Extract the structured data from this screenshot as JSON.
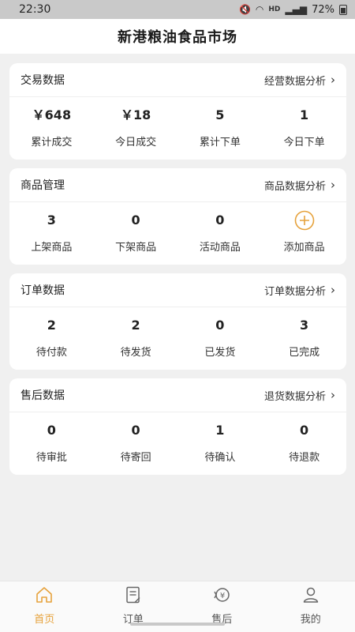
{
  "status_bar": {
    "time": "22:30",
    "network": "HD",
    "battery": "72%"
  },
  "header": {
    "title": "新港粮油食品市场"
  },
  "sections": [
    {
      "title": "交易数据",
      "link": "经营数据分析",
      "stats": [
        {
          "value": "￥648",
          "label": "累计成交"
        },
        {
          "value": "￥18",
          "label": "今日成交"
        },
        {
          "value": "5",
          "label": "累计下单"
        },
        {
          "value": "1",
          "label": "今日下单"
        }
      ]
    },
    {
      "title": "商品管理",
      "link": "商品数据分析",
      "stats": [
        {
          "value": "3",
          "label": "上架商品"
        },
        {
          "value": "0",
          "label": "下架商品"
        },
        {
          "value": "0",
          "label": "活动商品"
        },
        {
          "value": "",
          "label": "添加商品"
        }
      ]
    },
    {
      "title": "订单数据",
      "link": "订单数据分析",
      "stats": [
        {
          "value": "2",
          "label": "待付款"
        },
        {
          "value": "2",
          "label": "待发货"
        },
        {
          "value": "0",
          "label": "已发货"
        },
        {
          "value": "3",
          "label": "已完成"
        }
      ]
    },
    {
      "title": "售后数据",
      "link": "退货数据分析",
      "stats": [
        {
          "value": "0",
          "label": "待审批"
        },
        {
          "value": "0",
          "label": "待寄回"
        },
        {
          "value": "1",
          "label": "待确认"
        },
        {
          "value": "0",
          "label": "待退款"
        }
      ]
    }
  ],
  "tabbar": {
    "items": [
      {
        "label": "首页",
        "icon": "home-icon",
        "active": true
      },
      {
        "label": "订单",
        "icon": "order-icon",
        "active": false
      },
      {
        "label": "售后",
        "icon": "after-sales-icon",
        "active": false
      },
      {
        "label": "我的",
        "icon": "profile-icon",
        "active": false
      }
    ]
  },
  "colors": {
    "accent": "#e6a23c",
    "background": "#f0f0f0",
    "card": "#ffffff"
  }
}
